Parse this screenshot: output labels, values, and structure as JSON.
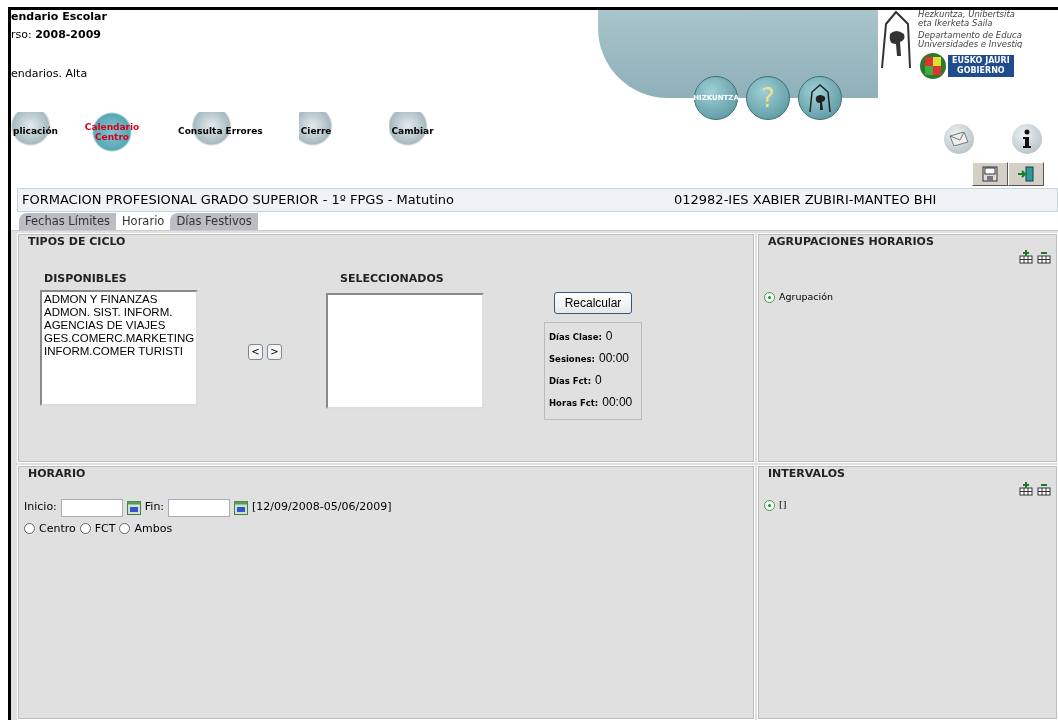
{
  "header": {
    "title": "endario Escolar",
    "course": "rso: **2008-2009**",
    "breadcrumb": "endarios. Alta"
  },
  "nav_items": [
    {
      "label": "plicación",
      "selected": false
    },
    {
      "label": "Calendario Centro",
      "selected": true
    },
    {
      "label": "Consulta Errores",
      "selected": false
    },
    {
      "label": "Cierre",
      "selected": false
    },
    {
      "label": "Cambiar",
      "selected": false
    }
  ],
  "banner": {
    "language_button": "HIZKUNTZA",
    "help_button": "?",
    "org_lines": [
      "Hezkuntza, Unibertsita",
      "eta Ikerketa Saila",
      "Departamento de Educa",
      "Universidades e Investig"
    ],
    "logo_lines": [
      "EUSKO JAURI",
      "GOBIERNO"
    ]
  },
  "context": {
    "program": "FORMACION PROFESIONAL GRADO SUPERIOR - 1º FPGS - Matutino",
    "center": "012982-IES XABIER ZUBIRI-MANTEO BHI"
  },
  "tabs": [
    {
      "label": "Fechas Límites",
      "selected": false
    },
    {
      "label": "Horario",
      "selected": true
    },
    {
      "label": "Días Festivos",
      "selected": false
    }
  ],
  "tipos_de_ciclo": {
    "title": "TIPOS DE CICLO",
    "available_label": "DISPONIBLES",
    "available_items": [
      "ADMON Y FINANZAS",
      "ADMON. SIST. INFORM.",
      "AGENCIAS DE VIAJES",
      "GES.COMERC.MARKETING",
      "INFORM.COMER TURISTI"
    ],
    "move_buttons": [
      "<",
      ">"
    ],
    "selected_label": "SELECCIONADOS",
    "recalc_button": "Recalcular",
    "stats": [
      {
        "label": "Días Clase:",
        "value": "0"
      },
      {
        "label": "Sesiones:",
        "value": "00:00"
      },
      {
        "label": "Días Fct:",
        "value": "0"
      },
      {
        "label": "Horas Fct:",
        "value": "00:00"
      }
    ]
  },
  "agrupaciones": {
    "title": "AGRUPACIONES HORARIOS",
    "options": [
      {
        "label": "Agrupación",
        "selected": true
      }
    ]
  },
  "horario": {
    "title": "HORARIO",
    "start_label": "Inicio:",
    "end_label": "Fin:",
    "range": "[12/09/2008-05/06/2009]",
    "options": [
      {
        "label": "Centro",
        "selected": false
      },
      {
        "label": "FCT",
        "selected": false
      },
      {
        "label": "Ambos",
        "selected": false
      }
    ]
  },
  "intervalos": {
    "title": "INTERVALOS",
    "options": [
      {
        "label": "[]",
        "selected": true
      }
    ]
  }
}
